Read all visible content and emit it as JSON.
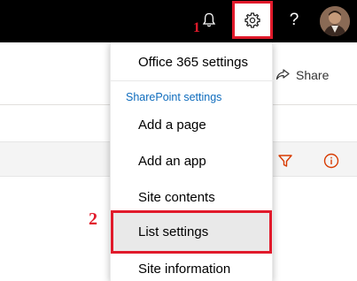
{
  "suite_bar": {
    "help_label": "?",
    "step1_label": "1"
  },
  "page": {
    "share_label": "Share"
  },
  "settings_menu": {
    "office_settings_label": "Office 365 settings",
    "section_heading": "SharePoint settings",
    "items": [
      {
        "label": "Add a page"
      },
      {
        "label": "Add an app"
      },
      {
        "label": "Site contents"
      },
      {
        "label": "List settings"
      },
      {
        "label": "Site information"
      }
    ]
  },
  "annotations": {
    "step2_label": "2",
    "highlight_color": "#e11a2b"
  },
  "icons": {
    "bell": "bell-icon",
    "gear": "gear-icon",
    "filter": "filter-icon",
    "info": "info-icon",
    "share": "share-icon"
  }
}
